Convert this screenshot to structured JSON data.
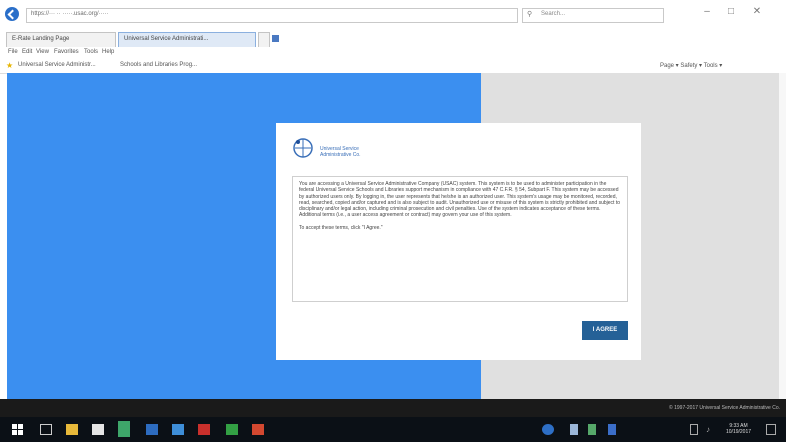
{
  "browser": {
    "address": "https://··· ·· ·····.usac.org/·····",
    "search_placeholder": "Search...",
    "tabs": [
      "E-Rate Landing Page",
      "Universal Service Administrati...",
      ""
    ],
    "menu": [
      "File",
      "Edit",
      "View",
      "Favorites",
      "Tools",
      "Help"
    ],
    "favorites": [
      "Universal Service Administr...",
      "Schools and Libraries Prog..."
    ],
    "command_bar": "Page ▾  Safety ▾  Tools ▾",
    "controls": {
      "minimize": "–",
      "maximize": "□",
      "close": "✕"
    }
  },
  "dialog": {
    "logo_text": "Universal Service\nAdministrative Co.",
    "notice": "You are accessing a Universal Service Administrative Company (USAC) system. This system is to be used to administer participation in the federal Universal Service Schools and Libraries support mechanism in compliance with 47 C.F.R. § 54, Subpart F. This system may be accessed by authorized users only. By logging in, the user represents that he/she is an authorized user. This system's usage may be monitored, recorded, read, searched, copied and/or captured and is also subject to audit. Unauthorized use or misuse of this system is strictly prohibited and subject to disciplinary and/or legal action, including criminal prosecution and civil penalties. Use of the system indicates acceptance of these terms. Additional terms (i.e., a user access agreement or contract) may govern your use of this system.",
    "instruction": "To accept these terms, click \"I Agree.\"",
    "agree_label": "I AGREE"
  },
  "footer": {
    "copyright": "© 1997-2017 Universal Service Administrative Co."
  },
  "taskbar": {
    "clock_time": "9:33 AM",
    "clock_date": "10/19/2017"
  },
  "colors": {
    "page_blue": "#3b8ff0",
    "button_blue": "#256197"
  }
}
